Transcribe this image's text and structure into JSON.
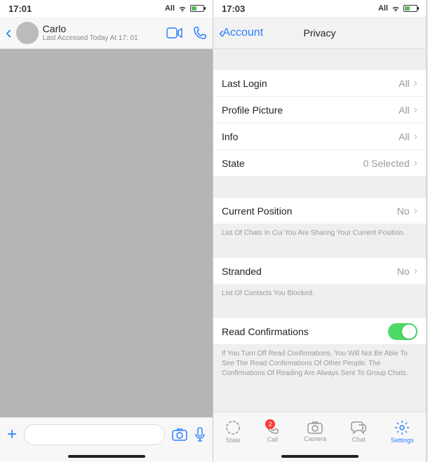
{
  "left": {
    "status": {
      "time": "17:01",
      "network": "All"
    },
    "chat": {
      "name": "Carlo",
      "status": "Last Accessed Today At 17: 01"
    }
  },
  "right": {
    "status": {
      "time": "17:03",
      "network": "All"
    },
    "header": {
      "back": "Account",
      "title": "Privacy"
    },
    "rows": {
      "last_login": {
        "label": "Last Login",
        "value": "All"
      },
      "profile_picture": {
        "label": "Profile Picture",
        "value": "All"
      },
      "info": {
        "label": "Info",
        "value": "All"
      },
      "state": {
        "label": "State",
        "value": "0 Selected"
      },
      "current_position": {
        "label": "Current Position",
        "value": "No"
      },
      "current_position_desc": "List Of Chats In Cui You Are Sharing Your Current Position.",
      "stranded": {
        "label": "Stranded",
        "value": "No"
      },
      "stranded_desc": "List Of Contacts You Blocked.",
      "read_confirmations": {
        "label": "Read Confirmations"
      },
      "read_confirmations_desc": "If You Turn Off Read Confirmations, You Will Not Be Able To See The Read Confirmations Of Other People. The Confirmations Of Reading Are Always Sent To Group Chats."
    },
    "tabs": {
      "state": "State",
      "call": "Call",
      "call_badge": "2",
      "camera": "Camera",
      "chat": "Chat",
      "settings": "Settings"
    }
  }
}
